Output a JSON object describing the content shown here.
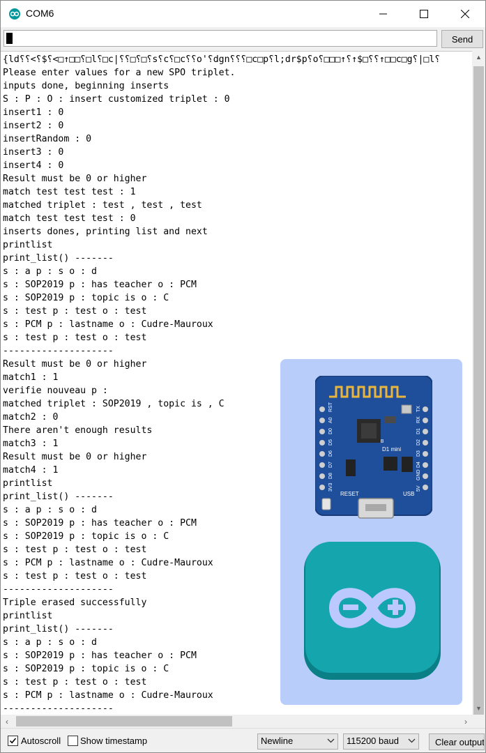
{
  "window": {
    "title": "COM6",
    "controls": {
      "minimize": "minimize",
      "maximize": "maximize",
      "close": "close"
    }
  },
  "input_row": {
    "value": "",
    "send_label": "Send"
  },
  "output_lines": [
    "{ld⸮⸮<⸮$⸮<□↑□□⸮□l⸮□c|⸮⸮□⸮□⸮s⸮c⸮□c⸮⸮o'⸮dgn⸮⸮⸮□c□p⸮l;dr$p⸮o⸮□□□↑⸮↑$□⸮⸮↑□□c□g⸮|□l⸮",
    "Please enter values for a new SPO triplet.",
    "inputs done, beginning inserts",
    "S : P : O : insert customized triplet : 0",
    "insert1 : 0",
    "insert2 : 0",
    "insertRandom : 0",
    "insert3 : 0",
    "insert4 : 0",
    "Result must be 0 or higher",
    "match test test test : 1",
    "matched triplet : test , test , test",
    "match test test test : 0",
    "inserts dones, printing list and next",
    "printlist",
    "print_list() -------",
    "s : a p : s o : d",
    "s : SOP2019 p : has teacher o : PCM",
    "s : SOP2019 p : topic is o : C",
    "s : test p : test o : test",
    "s : PCM p : lastname o : Cudre-Mauroux",
    "s : test p : test o : test",
    "--------------------",
    "Result must be 0 or higher",
    "match1 : 1",
    "verifie nouveau p :",
    "matched triplet : SOP2019 , topic is , C",
    "match2 : 0",
    "There aren't enough results",
    "match3 : 1",
    "Result must be 0 or higher",
    "match4 : 1",
    "printlist",
    "print_list() -------",
    "s : a p : s o : d",
    "s : SOP2019 p : has teacher o : PCM",
    "s : SOP2019 p : topic is o : C",
    "s : test p : test o : test",
    "s : PCM p : lastname o : Cudre-Mauroux",
    "s : test p : test o : test",
    "--------------------",
    "Triple erased successfully",
    "printlist",
    "print_list() -------",
    "s : a p : s o : d",
    "s : SOP2019 p : has teacher o : PCM",
    "s : SOP2019 p : topic is o : C",
    "s : test p : test o : test",
    "s : PCM p : lastname o : Cudre-Mauroux",
    "--------------------"
  ],
  "bottom_bar": {
    "autoscroll_label": "Autoscroll",
    "autoscroll_checked": true,
    "timestamp_label": "Show timestamp",
    "timestamp_checked": false,
    "line_ending": "Newline",
    "baud_rate": "115200 baud",
    "clear_label": "Clear output"
  },
  "overlay": {
    "board_labels": {
      "reset": "RESET",
      "usb": "USB",
      "model": "D1 mini",
      "chip": "4MB",
      "pins_left": [
        "RST",
        "A0",
        "D0",
        "D5",
        "D6",
        "D7",
        "D8",
        "3V3"
      ],
      "pins_right": [
        "TX",
        "RX",
        "D1",
        "D2",
        "D3",
        "D4",
        "GND",
        "5V"
      ]
    }
  },
  "colors": {
    "arduino_teal": "#00979c",
    "board_blue": "#1f4f9a",
    "overlay_bg": "#b9cdfb",
    "scroll_thumb": "#c1c1c1"
  },
  "icons": {
    "app": "arduino-icon",
    "minimize": "minimize-icon",
    "maximize": "maximize-icon",
    "close": "close-icon"
  }
}
